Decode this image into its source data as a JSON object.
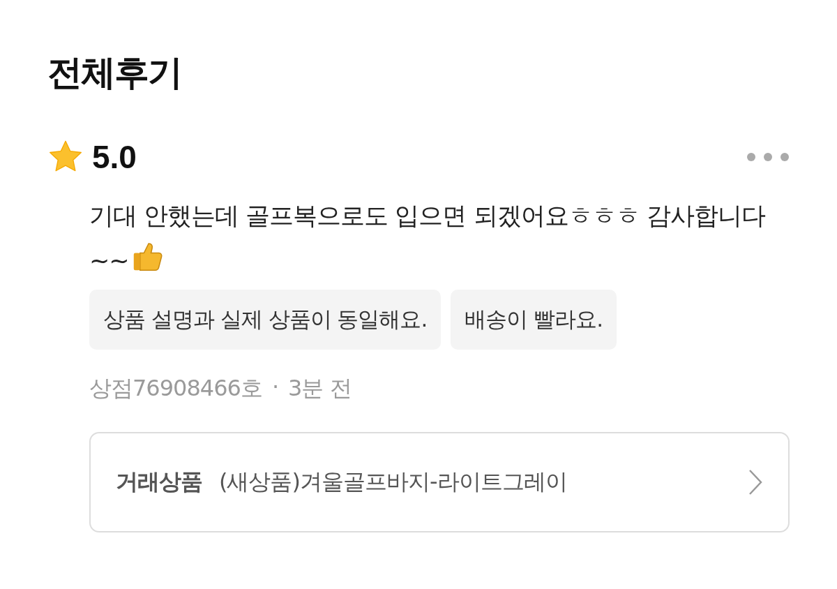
{
  "title": "전체후기",
  "review": {
    "rating": "5.0",
    "text": "기대 안했는데 골프복으로도 입으면 되겠어요ㅎㅎㅎ 감사합니다~~",
    "tags": [
      "상품 설명과 실제 상품이 동일해요.",
      "배송이 빨라요."
    ],
    "author": "상점76908466호",
    "separator": "·",
    "time": "3분 전",
    "product": {
      "label": "거래상품",
      "name": "(새상품)겨울골프바지-라이트그레이"
    }
  }
}
